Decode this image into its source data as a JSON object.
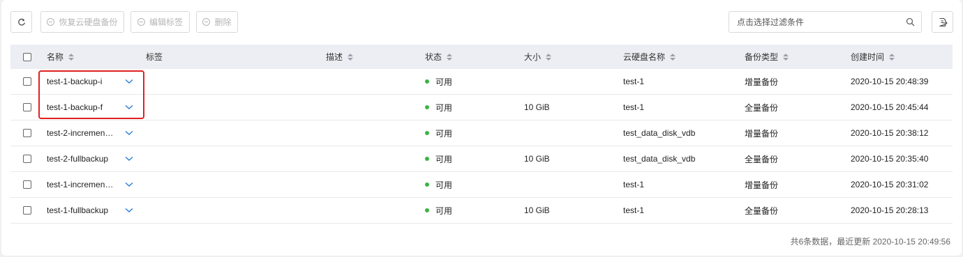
{
  "toolbar": {
    "restore_label": "恢复云硬盘备份",
    "edit_tags_label": "编辑标签",
    "delete_label": "删除",
    "search_placeholder": "点击选择过滤条件",
    "refresh_icon": "refresh-icon",
    "export_icon": "export-icon"
  },
  "columns": {
    "name": "名称",
    "tags": "标签",
    "desc": "描述",
    "status": "状态",
    "size": "大小",
    "volume": "云硬盘名称",
    "type": "备份类型",
    "created": "创建时间"
  },
  "rows": [
    {
      "name": "test-1-backup-i",
      "status": "可用",
      "size": "",
      "volume": "test-1",
      "type": "增量备份",
      "created": "2020-10-15 20:48:39"
    },
    {
      "name": "test-1-backup-f",
      "status": "可用",
      "size": "10 GiB",
      "volume": "test-1",
      "type": "全量备份",
      "created": "2020-10-15 20:45:44"
    },
    {
      "name": "test-2-incremen…",
      "status": "可用",
      "size": "",
      "volume": "test_data_disk_vdb",
      "type": "增量备份",
      "created": "2020-10-15 20:38:12"
    },
    {
      "name": "test-2-fullbackup",
      "status": "可用",
      "size": "10 GiB",
      "volume": "test_data_disk_vdb",
      "type": "全量备份",
      "created": "2020-10-15 20:35:40"
    },
    {
      "name": "test-1-incremen…",
      "status": "可用",
      "size": "",
      "volume": "test-1",
      "type": "增量备份",
      "created": "2020-10-15 20:31:02"
    },
    {
      "name": "test-1-fullbackup",
      "status": "可用",
      "size": "10 GiB",
      "volume": "test-1",
      "type": "全量备份",
      "created": "2020-10-15 20:28:13"
    }
  ],
  "colors": {
    "status_available": "#3bb346",
    "chevron": "#2b7fd4",
    "highlight": "#e02020",
    "header_bg": "#eceef3"
  },
  "footer": "共6条数据，最近更新 2020-10-15 20:49:56"
}
